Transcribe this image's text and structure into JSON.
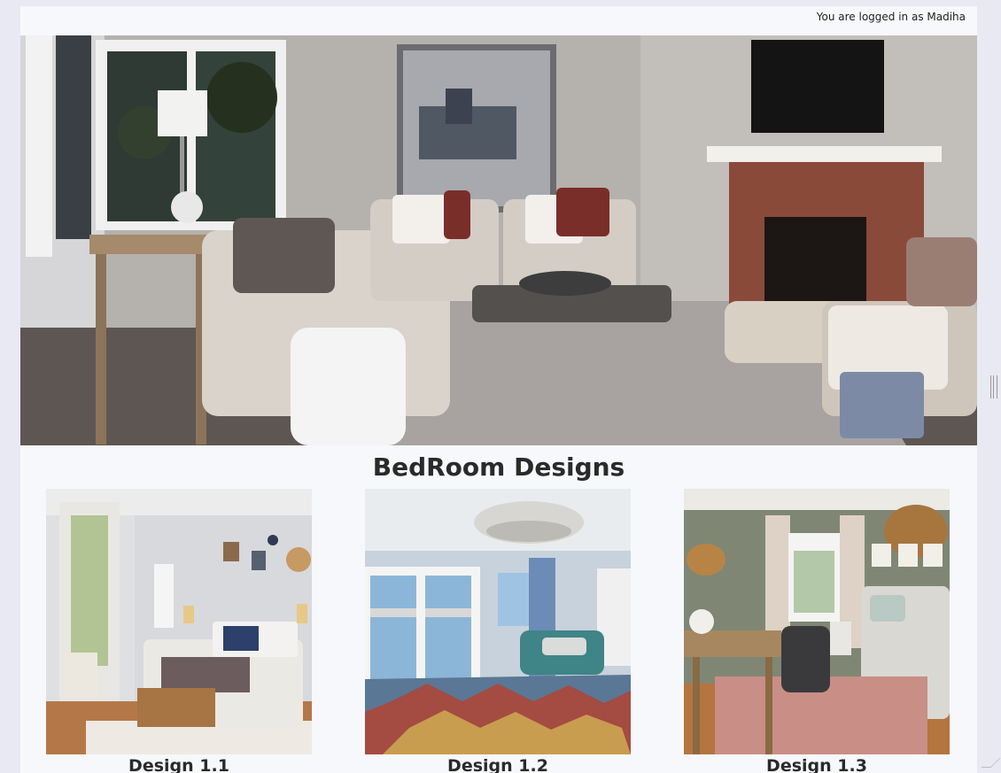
{
  "header": {
    "login_status": "You are logged in as Madiha"
  },
  "hero": {
    "image_subject": "living-room-photo"
  },
  "section": {
    "title": "BedRoom Designs"
  },
  "designs": [
    {
      "caption": "Design 1.1",
      "image_subject": "bright-bedroom-photo"
    },
    {
      "caption": "Design 1.2",
      "image_subject": "coastal-bedroom-photo"
    },
    {
      "caption": "Design 1.3",
      "image_subject": "bedroom-office-photo"
    }
  ],
  "colors": {
    "page_background": "#f7f8fb",
    "window_background": "#e8e9f3",
    "title_text": "#2a2a2a"
  }
}
